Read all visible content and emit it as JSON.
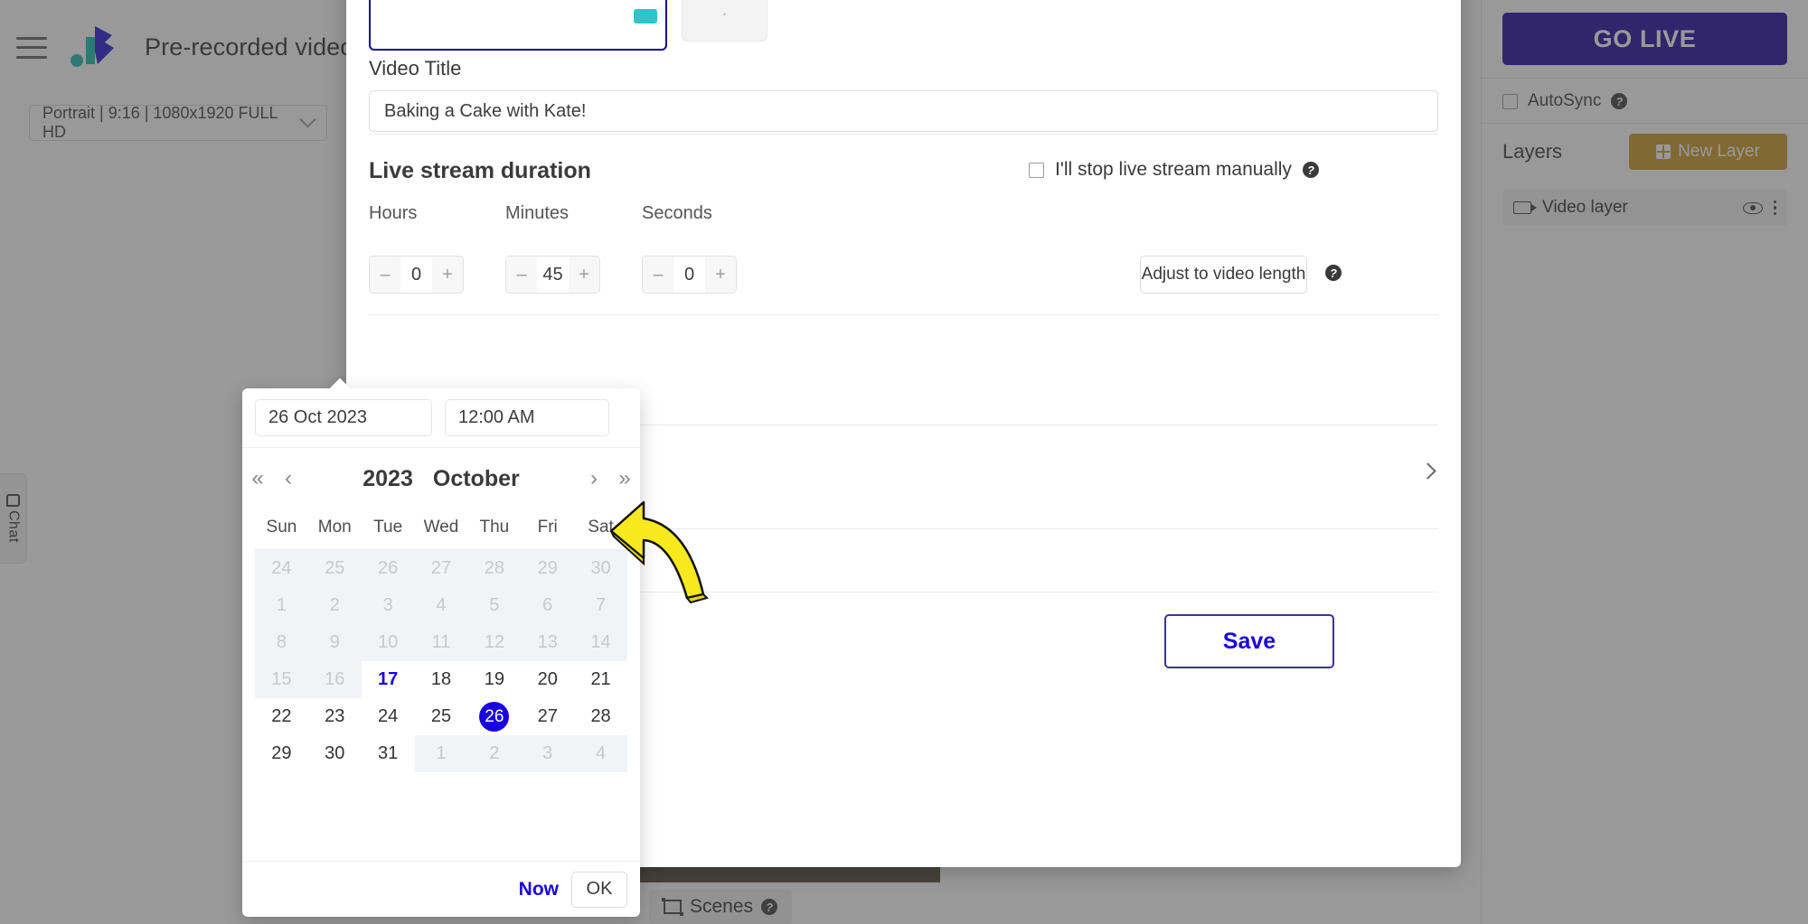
{
  "app": {
    "title": "Pre-recorded video o",
    "hamburger_icon": "hamburger-menu-icon",
    "logo_icon": "brand-logo-icon",
    "resolution_select": "Portrait | 9:16 | 1080x1920 FULL HD"
  },
  "chat_rail": {
    "label": "Chat",
    "icon": "chat-bubble-icon"
  },
  "right_panel": {
    "go_live_label": "GO LIVE",
    "go_live_color": "#1a009c",
    "autosync_label": "AutoSync",
    "autosync_checked": false,
    "help_icon": "question-mark-icon",
    "layers_title": "Layers",
    "new_layer_label": "New Layer",
    "new_layer_color": "#c9961f",
    "layers": [
      {
        "name": "Video layer",
        "icon": "video-camera-icon",
        "visible_icon": "eye-icon",
        "menu_icon": "more-vertical-icon"
      }
    ]
  },
  "bottom_bar": {
    "scenes_label": "Scenes",
    "scenes_icon": "scenes-frame-icon"
  },
  "modal": {
    "platforms": [
      {
        "name": "instagram",
        "icon": "instagram-icon",
        "selected": true
      },
      {
        "name": "add-platform",
        "icon": "add-platform-icon",
        "selected": false
      }
    ],
    "video_title_label": "Video Title",
    "video_title_value": "Baking a Cake with Kate!",
    "duration_section_title": "Live stream duration",
    "stop_manually_label": "I'll stop live stream manually",
    "stop_manually_checked": false,
    "duration": {
      "hours_label": "Hours",
      "hours_value": "0",
      "minutes_label": "Minutes",
      "minutes_value": "45",
      "seconds_label": "Seconds",
      "seconds_value": "0",
      "minus_label": "–",
      "plus_label": "+"
    },
    "adjust_button_label": "Adjust to video length",
    "expand_icon": "chevron-right-icon",
    "save_label": "Save"
  },
  "datepicker": {
    "date_value": "26 Oct 2023",
    "time_value": "12:00 AM",
    "prev_year_label": "«",
    "prev_month_label": "‹",
    "next_month_label": "›",
    "next_year_label": "»",
    "year": "2023",
    "month": "October",
    "weekday_headers": [
      "Sun",
      "Mon",
      "Tue",
      "Wed",
      "Thu",
      "Fri",
      "Sat"
    ],
    "weeks": [
      [
        {
          "d": "24",
          "s": "disabled"
        },
        {
          "d": "25",
          "s": "disabled"
        },
        {
          "d": "26",
          "s": "disabled"
        },
        {
          "d": "27",
          "s": "disabled"
        },
        {
          "d": "28",
          "s": "disabled"
        },
        {
          "d": "29",
          "s": "disabled"
        },
        {
          "d": "30",
          "s": "disabled"
        }
      ],
      [
        {
          "d": "1",
          "s": "disabled"
        },
        {
          "d": "2",
          "s": "disabled"
        },
        {
          "d": "3",
          "s": "disabled"
        },
        {
          "d": "4",
          "s": "disabled"
        },
        {
          "d": "5",
          "s": "disabled"
        },
        {
          "d": "6",
          "s": "disabled"
        },
        {
          "d": "7",
          "s": "disabled"
        }
      ],
      [
        {
          "d": "8",
          "s": "disabled"
        },
        {
          "d": "9",
          "s": "disabled"
        },
        {
          "d": "10",
          "s": "disabled"
        },
        {
          "d": "11",
          "s": "disabled"
        },
        {
          "d": "12",
          "s": "disabled"
        },
        {
          "d": "13",
          "s": "disabled"
        },
        {
          "d": "14",
          "s": "disabled"
        }
      ],
      [
        {
          "d": "15",
          "s": "disabled"
        },
        {
          "d": "16",
          "s": "disabled"
        },
        {
          "d": "17",
          "s": "today"
        },
        {
          "d": "18",
          "s": ""
        },
        {
          "d": "19",
          "s": ""
        },
        {
          "d": "20",
          "s": ""
        },
        {
          "d": "21",
          "s": ""
        }
      ],
      [
        {
          "d": "22",
          "s": ""
        },
        {
          "d": "23",
          "s": ""
        },
        {
          "d": "24",
          "s": ""
        },
        {
          "d": "25",
          "s": ""
        },
        {
          "d": "26",
          "s": "selected"
        },
        {
          "d": "27",
          "s": ""
        },
        {
          "d": "28",
          "s": ""
        }
      ],
      [
        {
          "d": "29",
          "s": ""
        },
        {
          "d": "30",
          "s": ""
        },
        {
          "d": "31",
          "s": ""
        },
        {
          "d": "1",
          "s": "disabled"
        },
        {
          "d": "2",
          "s": "disabled"
        },
        {
          "d": "3",
          "s": "disabled"
        },
        {
          "d": "4",
          "s": "disabled"
        }
      ]
    ],
    "now_label": "Now",
    "ok_label": "OK",
    "selected_color": "#1a00e0"
  },
  "annotation": {
    "arrow_icon": "yellow-curved-arrow",
    "color": "#f7e91e"
  }
}
